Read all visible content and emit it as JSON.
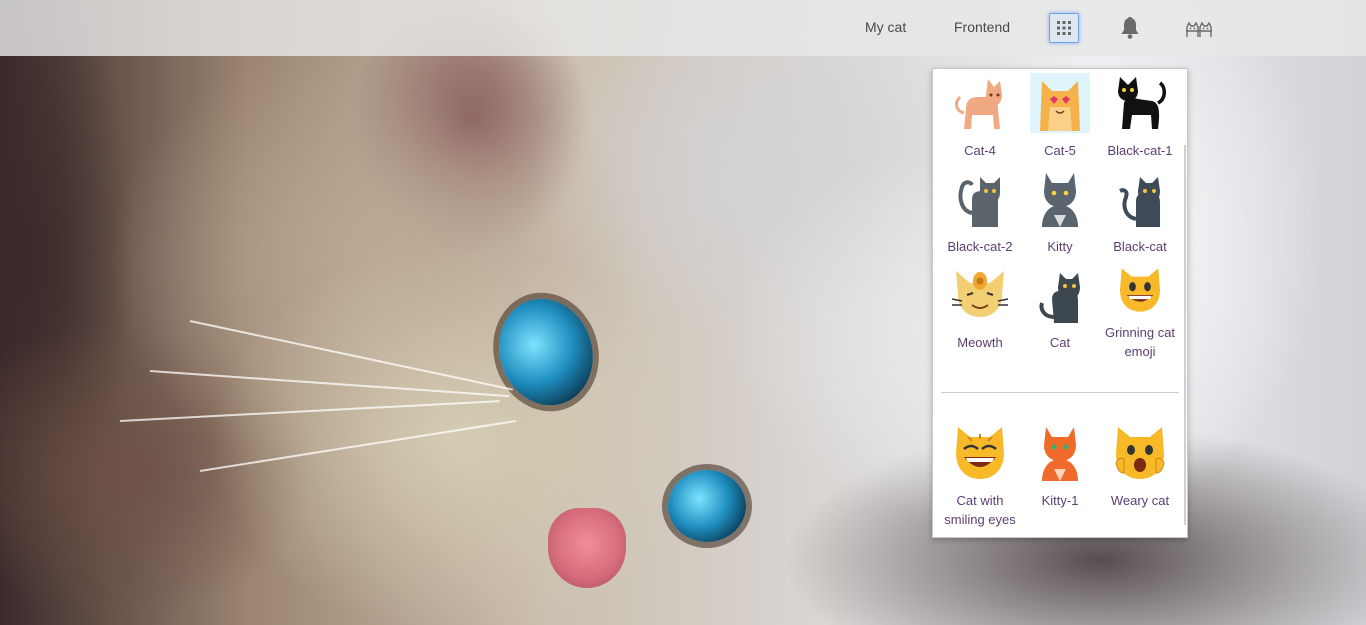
{
  "topbar": {
    "links": [
      "My cat",
      "Frontend"
    ],
    "apps_icon": "grid-icon",
    "notifications_icon": "bell-icon",
    "user_icon": "cats-icon"
  },
  "apps": {
    "group1": [
      {
        "label": "Cat-4",
        "icon": "cat-4-icon"
      },
      {
        "label": "Cat-5",
        "icon": "cat-5-icon"
      },
      {
        "label": "Black-cat-1",
        "icon": "black-cat-1-icon"
      },
      {
        "label": "Black-cat-2",
        "icon": "black-cat-2-icon"
      },
      {
        "label": "Kitty",
        "icon": "kitty-icon"
      },
      {
        "label": "Black-cat",
        "icon": "black-cat-icon"
      },
      {
        "label": "Meowth",
        "icon": "meowth-icon"
      },
      {
        "label": "Cat",
        "icon": "cat-icon"
      },
      {
        "label": "Grinning cat emoji",
        "icon": "grinning-cat-icon"
      }
    ],
    "group2": [
      {
        "label": "Cat with smiling eyes",
        "icon": "smiling-eyes-cat-icon"
      },
      {
        "label": "Kitty-1",
        "icon": "kitty-1-icon"
      },
      {
        "label": "Weary cat",
        "icon": "weary-cat-icon"
      }
    ]
  },
  "colors": {
    "link_text": "#5b3f73",
    "active_border": "#6aa7e8"
  }
}
